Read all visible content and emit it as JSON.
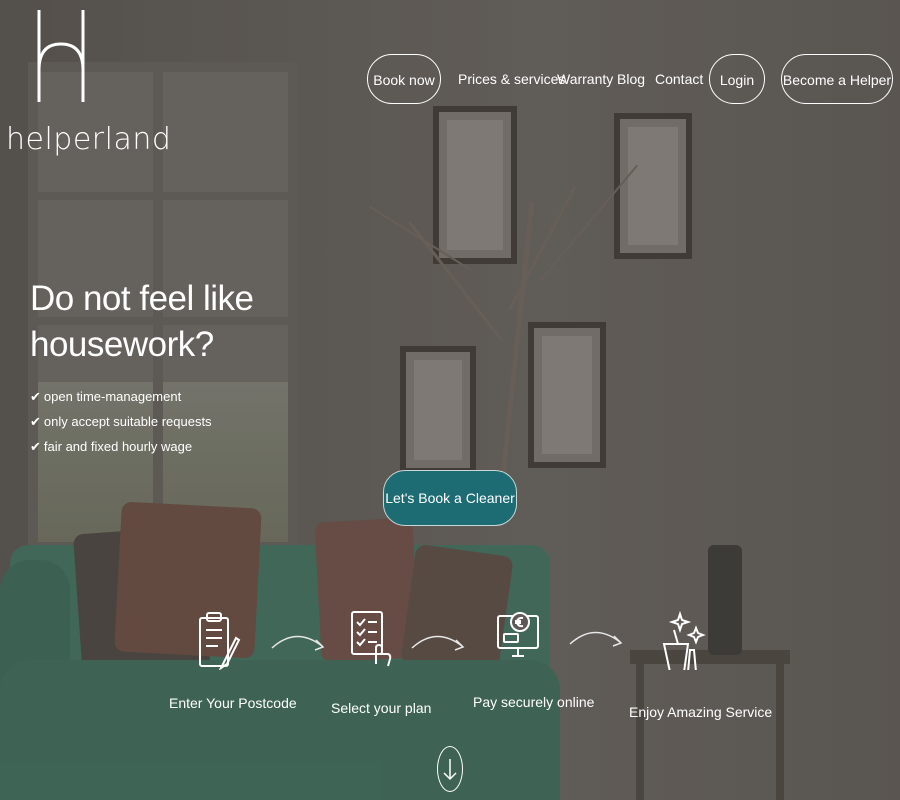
{
  "brand": {
    "logo_text": "helperland"
  },
  "nav": {
    "book_now": "Book now",
    "prices_services": "Prices & services",
    "warranty": "Warranty",
    "blog": "Blog",
    "contact": "Contact",
    "login": "Login",
    "become_helper": "Become a Helper"
  },
  "hero": {
    "title": "Do not feel like housework?",
    "checks": [
      "open time-management",
      "only accept suitable requests",
      "fair and fixed hourly wage"
    ],
    "cta_label": "Let's Book a Cleaner"
  },
  "steps": [
    {
      "label": "Enter Your Postcode",
      "icon": "clipboard-pencil-icon"
    },
    {
      "label": "Select your plan",
      "icon": "checklist-hand-icon"
    },
    {
      "label": "Pay securely online",
      "icon": "monitor-euro-icon"
    },
    {
      "label": "Enjoy Amazing Service",
      "icon": "cleaning-sparkle-icon"
    }
  ],
  "scroll_icon": "arrow-down-icon",
  "colors": {
    "cta_bg": "#1d6b73",
    "text": "#ffffff",
    "sofa": "#3f6f5e"
  }
}
